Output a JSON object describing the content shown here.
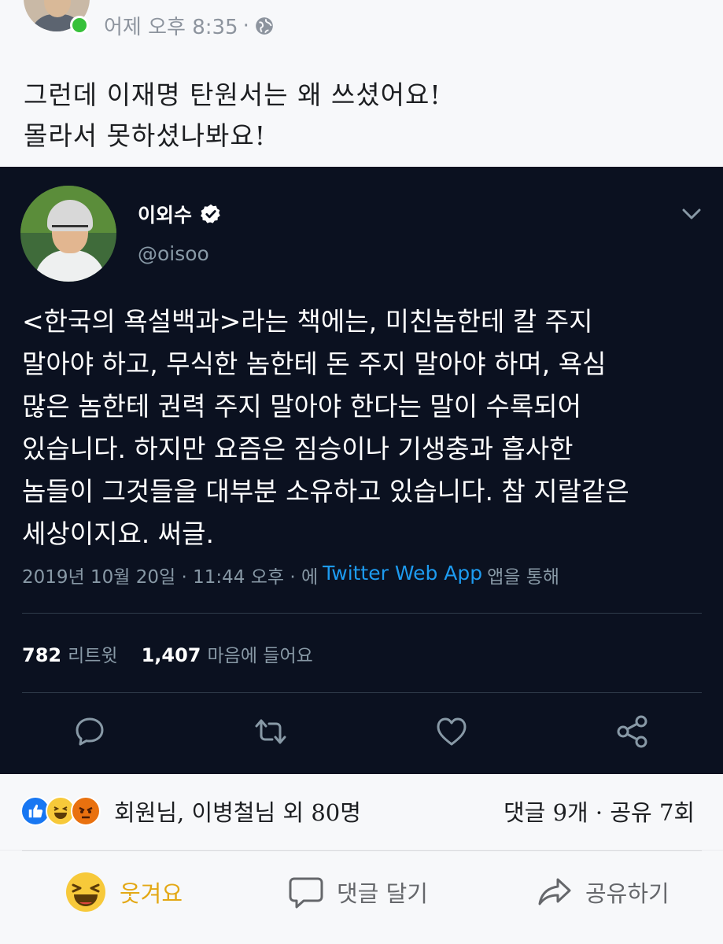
{
  "post": {
    "time": "어제 오후 8:35",
    "separator": "·",
    "text_line1": "그런데 이재명 탄원서는 왜 쓰셨어요!",
    "text_line2": "몰라서 못하셨나봐요!"
  },
  "tweet": {
    "name": "이외수",
    "handle": "@oisoo",
    "body_lines": [
      "<한국의 욕설백과>라는 책에는, 미친놈한테 칼 주지",
      "말아야 하고, 무식한 놈한테 돈 주지 말아야 하며, 욕심",
      "많은 놈한테 권력 주지 말아야 한다는 말이 수록되어",
      "있습니다. 하지만 요즘은 짐승이나 기생충과 흡사한",
      "놈들이 그것들을 대부분 소유하고 있습니다. 참 지랄같은",
      "세상이지요. 써글."
    ],
    "timestamp": "2019년 10월 20일 · 11:44 오후 · 에",
    "source": "Twitter Web App",
    "source_suffix": "앱을 통해",
    "retweets": "782",
    "retweets_label": "리트윗",
    "likes": "1,407",
    "likes_label": "마음에 들어요",
    "accent": "#1d9bf0"
  },
  "reactions": {
    "names": "회원님, 이병철님 외 80명",
    "counts": "댓글 9개 · 공유 7회",
    "icons": [
      "like-icon",
      "haha-icon",
      "angry-icon"
    ]
  },
  "actions": {
    "laugh": "웃겨요",
    "comment": "댓글 달기",
    "share": "공유하기"
  }
}
